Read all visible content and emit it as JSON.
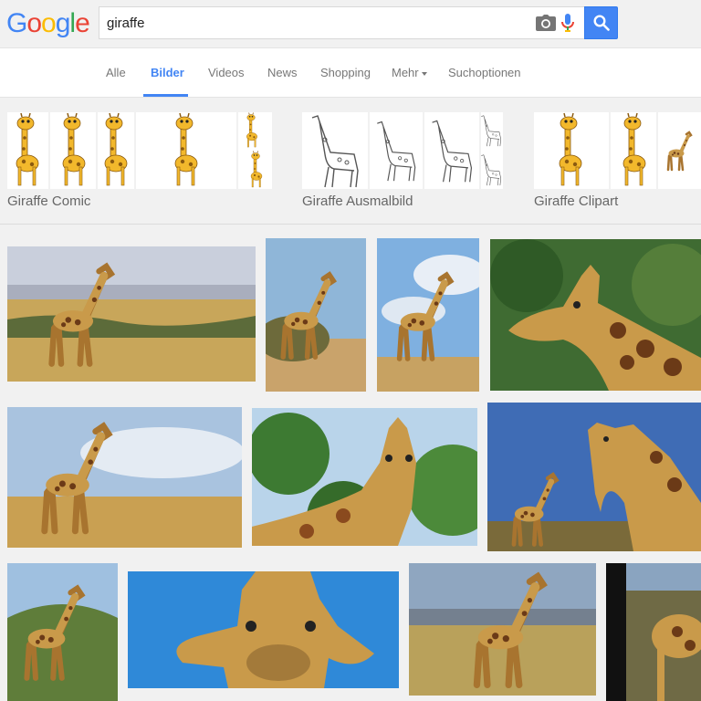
{
  "logo": {
    "letters": [
      "G",
      "o",
      "o",
      "g",
      "l",
      "e"
    ],
    "colors": [
      "#4285f4",
      "#ea4335",
      "#fbbc05",
      "#4285f4",
      "#34a853",
      "#ea4335"
    ]
  },
  "search": {
    "query": "giraffe",
    "icons": [
      "camera-icon",
      "microphone-icon",
      "search-icon"
    ]
  },
  "tabs": [
    {
      "label": "Alle"
    },
    {
      "label": "Bilder",
      "active": true
    },
    {
      "label": "Videos"
    },
    {
      "label": "News"
    },
    {
      "label": "Shopping"
    },
    {
      "label": "Mehr"
    },
    {
      "label": "Suchoptionen"
    }
  ],
  "related": [
    {
      "label": "Giraffe Comic"
    },
    {
      "label": "Giraffe Ausmalbild"
    },
    {
      "label": "Giraffe Clipart"
    }
  ],
  "colors": {
    "accent": "#4285f4",
    "giraffe": "#c99a4a",
    "spot": "#6b3a17",
    "sky": "#9fc6e8",
    "grass": "#c9a85a"
  }
}
